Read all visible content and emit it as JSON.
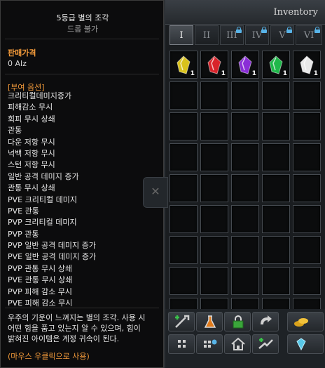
{
  "tooltip": {
    "title": "5등급 별의 조각",
    "subtitle": "드롭 불가",
    "price_label": "판매가격",
    "price_value": "0 Alz",
    "options_header": "[부여 옵션]",
    "options": [
      "크리티컬데미지증가",
      "피해감소 무시",
      "회피 무시 상쇄",
      "관통",
      "다운 저항 무시",
      "넉백 저항 무시",
      "스턴 저항 무시",
      "일반 공격 데미지 증가",
      "관통 무시 상쇄",
      "PVE 크리티컬 데미지",
      "PVE 관통",
      "PVP 크리티컬 데미지",
      "PVP 관통",
      "PVP 일반 공격 데미지 증가",
      "PVE 일반 공격 데미지 증가",
      "PVP 관통 무시 상쇄",
      "PVE 관통 무시 상쇄",
      "PVP 피해 감소 무시",
      "PVE 피해 감소 무시"
    ],
    "description": [
      "우주의 기운이 느껴지는 별의 조각. 사용 시",
      "어떤 힘을 품고 있는지 알 수 있으며, 힘이",
      "밝혀진 아이템은 계정 귀속이 된다."
    ],
    "usage_hint": "(마우스 우클릭으로 사용)"
  },
  "inventory": {
    "title": "Inventory",
    "tabs": [
      {
        "label": "I",
        "active": true,
        "locked": false
      },
      {
        "label": "II",
        "active": false,
        "locked": false
      },
      {
        "label": "III",
        "active": false,
        "locked": true
      },
      {
        "label": "IV",
        "active": false,
        "locked": true
      },
      {
        "label": "V",
        "active": false,
        "locked": true
      },
      {
        "label": "VI",
        "active": false,
        "locked": true
      }
    ],
    "items": [
      {
        "name": "yellow-star-fragment",
        "color": "#d9c21c",
        "qty": "1"
      },
      {
        "name": "red-star-fragment",
        "color": "#d8232a",
        "qty": "1"
      },
      {
        "name": "purple-star-fragment",
        "color": "#8a2ed6",
        "qty": "1"
      },
      {
        "name": "green-star-fragment",
        "color": "#1fb84a",
        "qty": "1"
      },
      {
        "name": "white-star-fragment",
        "color": "#e8e8e8",
        "qty": "1"
      }
    ],
    "bottom_buttons": [
      "repair-sword-icon",
      "potion-flask-icon",
      "lock-icon",
      "arrow-cycle-icon",
      "gold-coins-icon",
      "grid-icon",
      "sort-gear-icon",
      "house-icon",
      "wing-arrow-icon",
      "gem-diamond-icon"
    ],
    "colors": {
      "tooltip_accent": "#f29a3a",
      "lock": "#58b4e8"
    }
  }
}
